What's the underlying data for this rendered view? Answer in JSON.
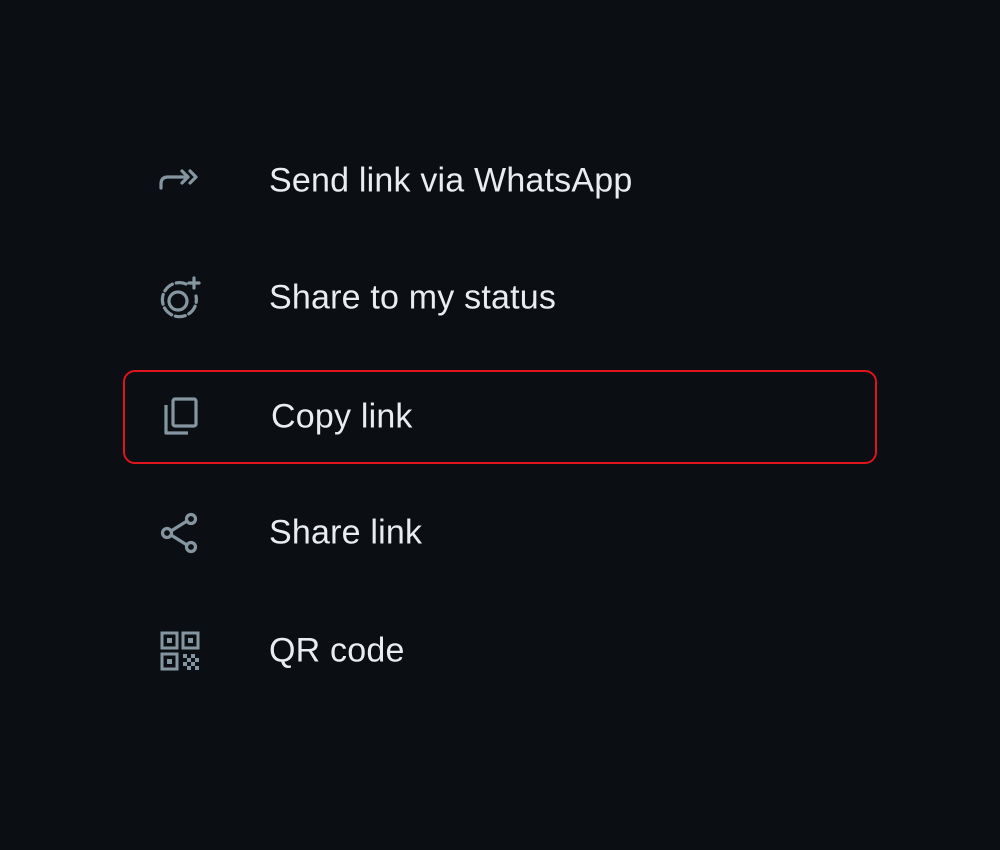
{
  "menu": {
    "items": [
      {
        "id": "send",
        "icon": "forward-arrow-icon",
        "label": "Send link via WhatsApp",
        "highlighted": false
      },
      {
        "id": "status",
        "icon": "status-add-icon",
        "label": "Share to my status",
        "highlighted": false
      },
      {
        "id": "copy",
        "icon": "copy-icon",
        "label": "Copy link",
        "highlighted": true
      },
      {
        "id": "share",
        "icon": "share-icon",
        "label": "Share link",
        "highlighted": false
      },
      {
        "id": "qr",
        "icon": "qr-code-icon",
        "label": "QR code",
        "highlighted": false
      }
    ]
  },
  "colors": {
    "background": "#0b0f13",
    "text": "#e9edef",
    "icon": "#8696a0",
    "highlight_border": "#e0141e"
  }
}
